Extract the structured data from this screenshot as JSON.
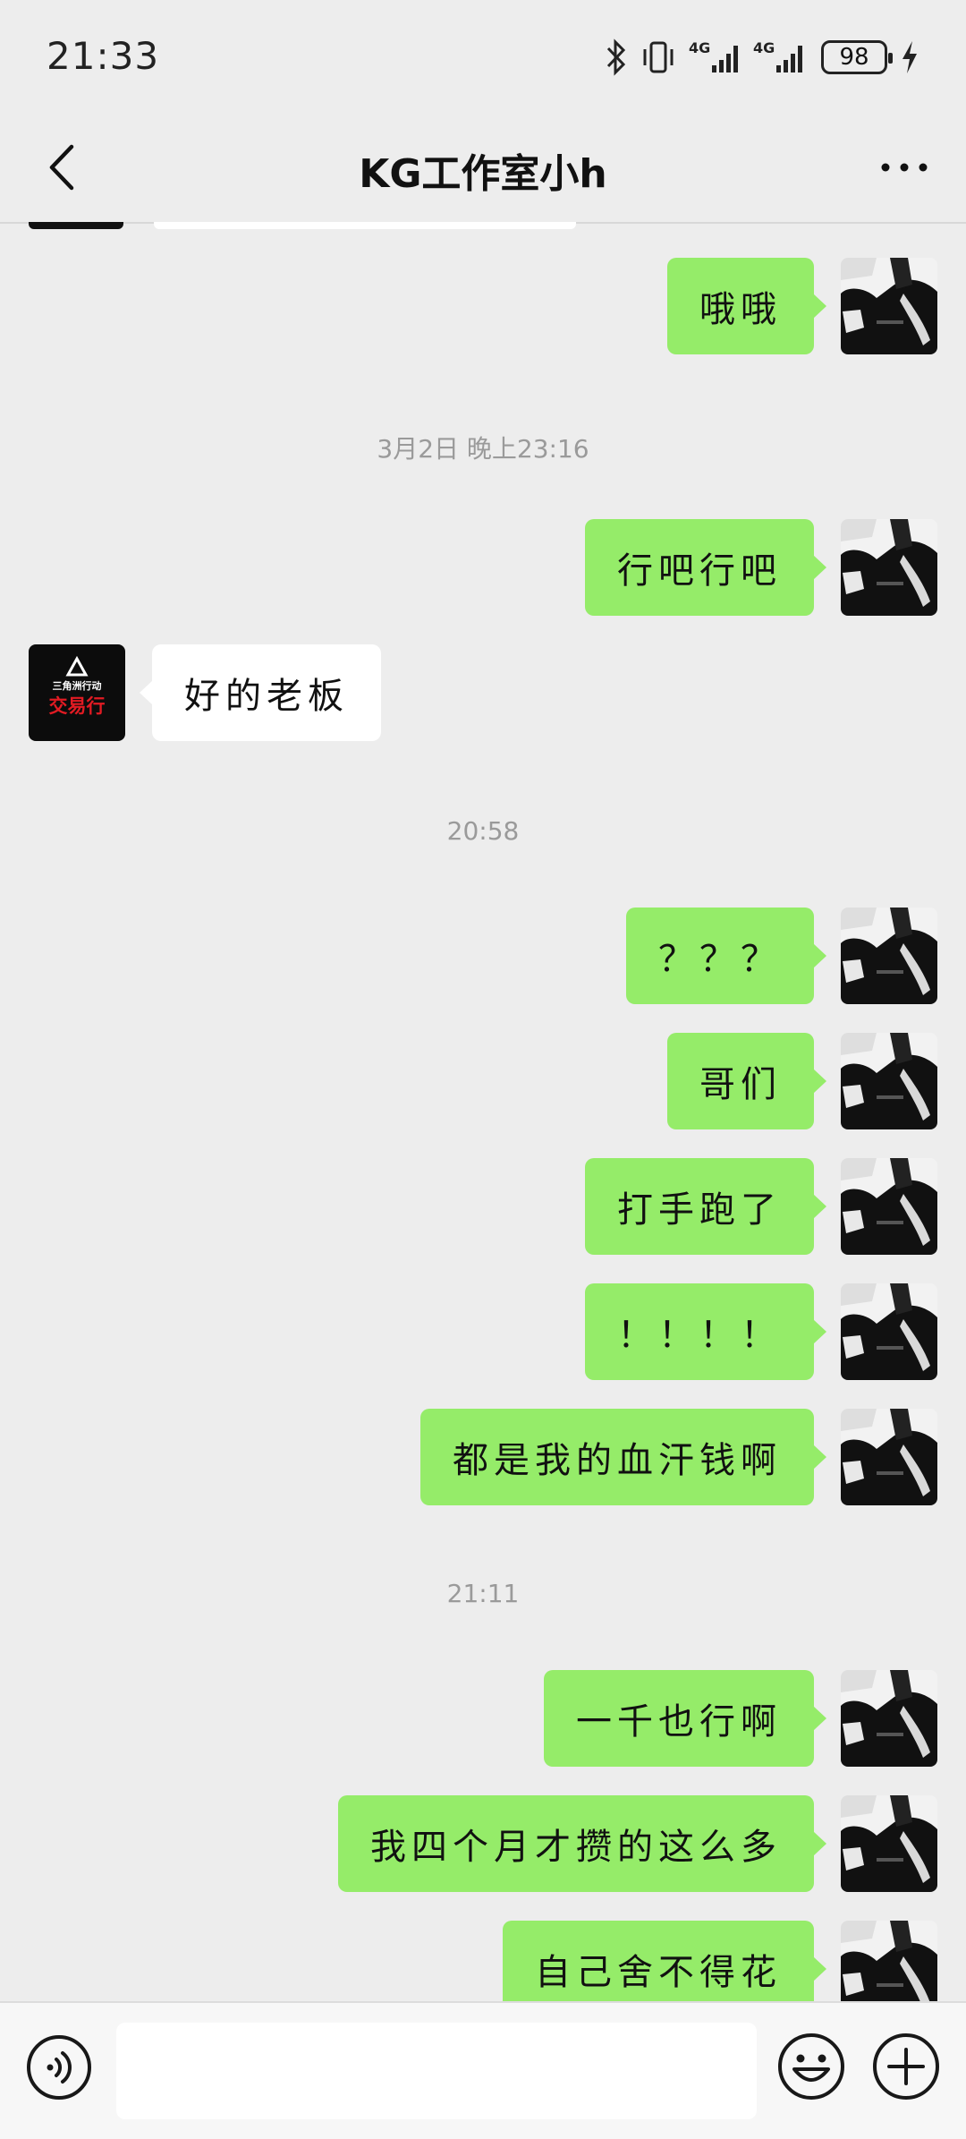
{
  "status_bar": {
    "time": "21:33",
    "network_1": "4G",
    "network_2": "4G",
    "battery": "98"
  },
  "header": {
    "title": "KG工作室小h"
  },
  "messages": [
    {
      "from": "me",
      "text": "哦哦"
    },
    {
      "timestamp": "3月2日 晚上23:16"
    },
    {
      "from": "me",
      "text": "行吧行吧"
    },
    {
      "from": "them",
      "text": "好的老板",
      "avatar_text_top": "三角洲行动",
      "avatar_text_main": "交易行"
    },
    {
      "timestamp": "20:58"
    },
    {
      "from": "me",
      "text": "？？？"
    },
    {
      "from": "me",
      "text": "哥们"
    },
    {
      "from": "me",
      "text": "打手跑了"
    },
    {
      "from": "me",
      "text": "！！！！"
    },
    {
      "from": "me",
      "text": "都是我的血汗钱啊"
    },
    {
      "timestamp": "21:11"
    },
    {
      "from": "me",
      "text": "一千也行啊"
    },
    {
      "from": "me",
      "text": "我四个月才攒的这么多"
    },
    {
      "from": "me",
      "text": "自己舍不得花"
    }
  ],
  "input_bar": {
    "placeholder": "",
    "voice_icon": "voice-icon",
    "emoji_icon": "emoji-icon",
    "plus_icon": "plus-icon"
  },
  "colors": {
    "background": "#ededed",
    "my_bubble": "#95ec69",
    "their_bubble": "#ffffff"
  }
}
